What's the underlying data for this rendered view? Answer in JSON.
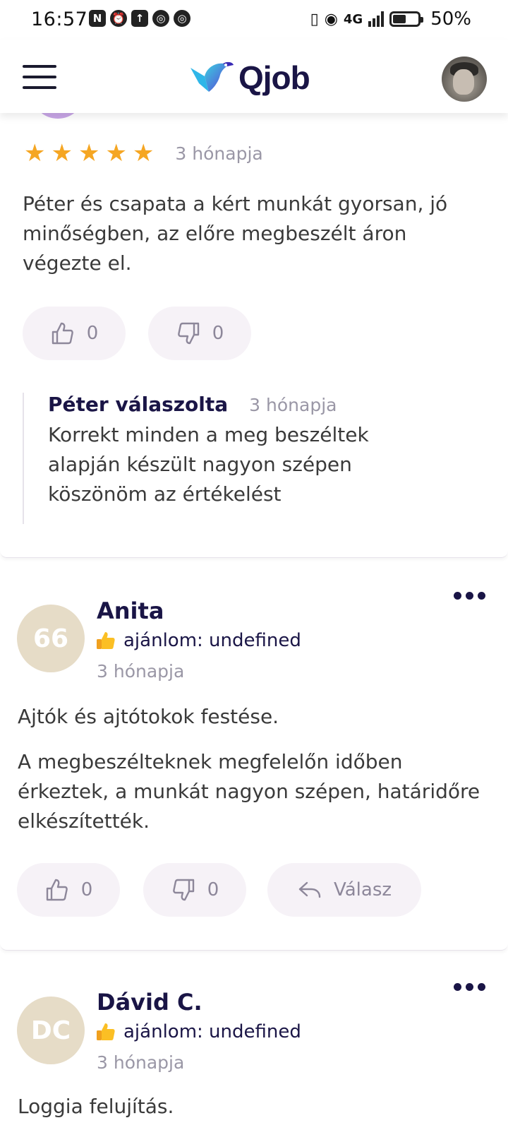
{
  "status_bar": {
    "time": "16:57",
    "network": "4G",
    "sim": "1",
    "battery": "50%"
  },
  "header": {
    "brand": "Qjob",
    "icons": [
      "hamburger-menu-icon",
      "qjob-logo",
      "user-avatar"
    ]
  },
  "reviews": [
    {
      "rating": 5,
      "time": "3 hónapja",
      "text": "Péter és csapata a kért munkát gyorsan, jó minőségben, az előre megbeszélt áron végezte el.",
      "likes": "0",
      "dislikes": "0",
      "reply": {
        "author": "Péter válaszolta",
        "time": "3 hónapja",
        "text": "Korrekt minden a meg beszéltek alapján készült nagyon szépen köszönöm az értékelést"
      }
    },
    {
      "avatar_initials": "66",
      "author": "Anita",
      "recommend": "ajánlom: undefined",
      "time": "3 hónapja",
      "title": "Ajtók és ajtótokok festése.",
      "text": "A megbeszélteknek megfelelőn időben érkeztek, a munkát nagyon szépen, határidőre elkészítették.",
      "likes": "0",
      "dislikes": "0",
      "reply_label": "Válasz"
    },
    {
      "avatar_initials": "DC",
      "author": "Dávid C.",
      "recommend": "ajánlom: undefined",
      "time": "3 hónapja",
      "title": "Loggia felujítás."
    }
  ],
  "colors": {
    "star": "#f5a623",
    "brand_dark": "#1a1546",
    "pill_bg": "#f6f2f7",
    "avatar_bg": "#e6dcc7"
  }
}
